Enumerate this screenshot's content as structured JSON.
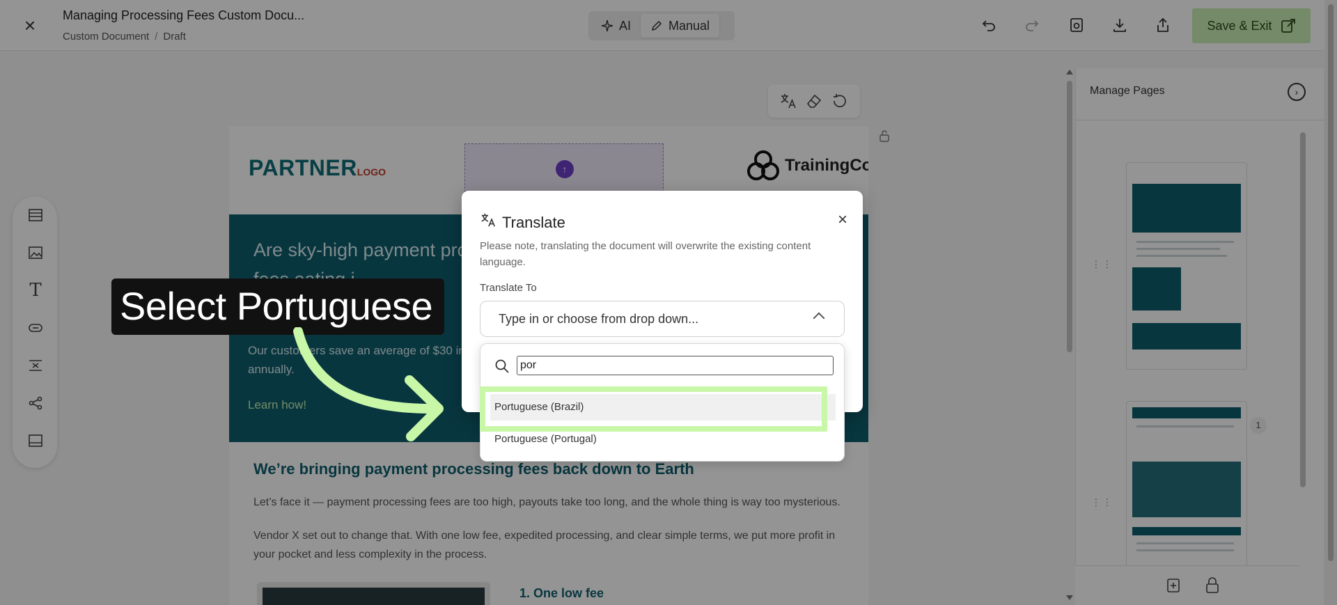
{
  "header": {
    "close_symbol": "×",
    "doc_title": "Managing Processing Fees Custom Docu...",
    "breadcrumb": [
      "Custom Document",
      "Draft"
    ],
    "breadcrumb_sep": "/",
    "modes": [
      {
        "label": "AI",
        "icon": "sparkle-icon"
      },
      {
        "label": "Manual",
        "icon": "pencil-icon"
      }
    ],
    "save_label": "Save & Exit"
  },
  "document": {
    "partner_logo": "PARTNER",
    "partner_logo_sub": "LOGO",
    "brand_name": "TrainingCo",
    "hero_title": "Are sky-high payment processing fees eating i",
    "hero_sub": "Our customers save an average of $30 in fees annually.",
    "hero_link": "Learn how!",
    "section_title": "We’re bringing payment processing fees back down to Earth",
    "para1": "Let’s face it — payment processing fees are too high, payouts take too long, and the whole thing is way too mysterious.",
    "para2": "Vendor X set out to change that. With one low fee, expedited processing, and clear simple terms, we put more profit in your pocket and less complexity in the process.",
    "list_head": "1. One low fee"
  },
  "right_panel": {
    "title": "Manage Pages",
    "page_number": "1"
  },
  "modal": {
    "title": "Translate",
    "note": "Please note, translating the document will overwrite the existing content language.",
    "field_label": "Translate To",
    "select_placeholder": "Type in or choose from drop down...",
    "close_symbol": "×"
  },
  "dropdown": {
    "search_value": "por",
    "options": [
      "Portuguese (Brazil)",
      "Portuguese (Portugal)"
    ]
  },
  "callout": {
    "text": "Select Portuguese"
  },
  "colors": {
    "accent_green": "#c9f7a8",
    "teal": "#0f5e6d",
    "save_bg": "#c9eeb3"
  }
}
